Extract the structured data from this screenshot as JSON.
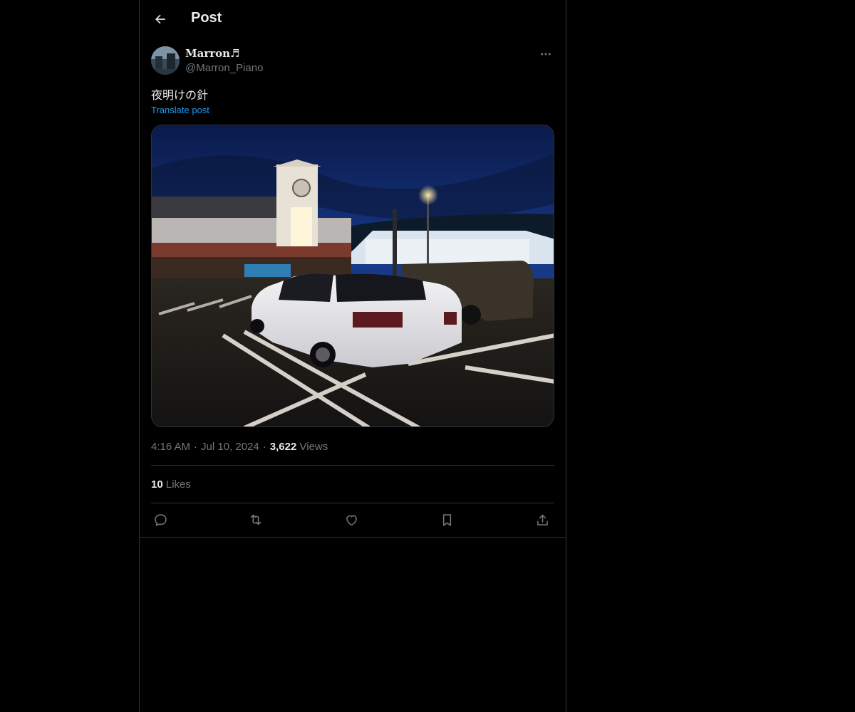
{
  "header": {
    "title": "Post",
    "back_icon": "arrow-left-icon"
  },
  "author": {
    "display_name": "Marron♬",
    "handle": "@Marron_Piano"
  },
  "post": {
    "text": "夜明けの針",
    "translate_label": "Translate post",
    "time": "4:16 AM",
    "date": "Jul 10, 2024",
    "views_count": "3,622",
    "views_label": "Views",
    "separator": "·"
  },
  "engagement": {
    "likes_count": "10",
    "likes_label": "Likes"
  },
  "actions": [
    {
      "name": "reply",
      "icon": "reply-icon"
    },
    {
      "name": "repost",
      "icon": "repost-icon"
    },
    {
      "name": "like",
      "icon": "heart-icon"
    },
    {
      "name": "bookmark",
      "icon": "bookmark-icon"
    },
    {
      "name": "share",
      "icon": "share-icon"
    }
  ],
  "colors": {
    "background": "#000000",
    "text_primary": "#e7e9ea",
    "text_secondary": "#71767b",
    "link": "#1d9bf0",
    "border": "#2f3336"
  }
}
